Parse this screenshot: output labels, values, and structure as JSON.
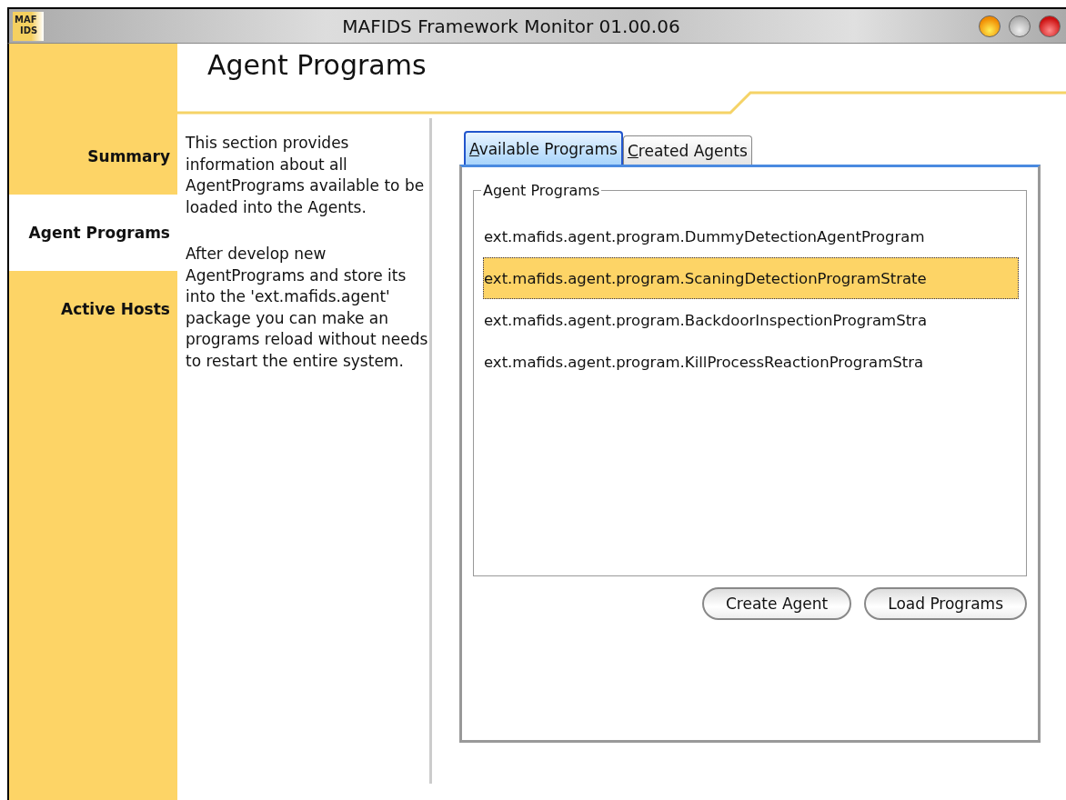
{
  "window": {
    "title": "MAFIDS Framework Monitor 01.00.06",
    "logo": [
      "MAF",
      "IDS"
    ]
  },
  "header": {
    "title": "Agent Programs"
  },
  "sidebar": {
    "items": [
      {
        "label": "Summary",
        "selected": false
      },
      {
        "label": "Agent Programs",
        "selected": true
      },
      {
        "label": "Active Hosts",
        "selected": false
      }
    ]
  },
  "description": [
    "This section provides information about all AgentPrograms available to be loaded into the Agents.",
    "After develop new AgentPrograms and store its into the 'ext.mafids.agent' package you can make an programs reload without needs to restart the entire system."
  ],
  "tabs": [
    {
      "label": "Available Programs",
      "selected": true
    },
    {
      "label": "Created Agents",
      "selected": false
    }
  ],
  "programs": {
    "title": "Agent Programs",
    "items": [
      {
        "label": "ext.mafids.agent.program.DummyDetectionAgentProgram",
        "selected": false
      },
      {
        "label": "ext.mafids.agent.program.ScaningDetectionProgramStrate",
        "selected": true
      },
      {
        "label": "ext.mafids.agent.program.BackdoorInspectionProgramStra",
        "selected": false
      },
      {
        "label": "ext.mafids.agent.program.KillProcessReactionProgramStra",
        "selected": false
      }
    ]
  },
  "buttons": [
    "Create Agent",
    "Load Programs"
  ]
}
